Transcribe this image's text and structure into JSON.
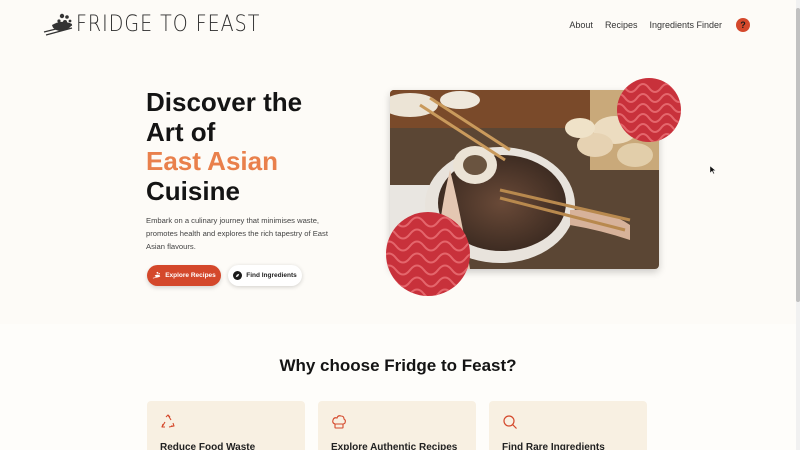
{
  "brand": {
    "name": "FRIDGE TO FEAST"
  },
  "nav": {
    "items": [
      "About",
      "Recipes",
      "Ingredients Finder"
    ],
    "help_label": "?"
  },
  "hero": {
    "title_line1": "Discover the",
    "title_line2": "Art of",
    "title_accent": "East Asian",
    "title_line4": "Cuisine",
    "description": "Embark on a culinary journey that minimises waste, promotes health and explores the rich tapestry of East Asian flavours.",
    "primary_button": "Explore Recipes",
    "secondary_button": "Find Ingredients"
  },
  "why": {
    "title": "Why choose Fridge to Feast?",
    "cards": [
      {
        "title": "Reduce Food Waste",
        "icon": "recycle-icon"
      },
      {
        "title": "Explore Authentic Recipes",
        "icon": "chef-hat-icon"
      },
      {
        "title": "Find Rare Ingredients",
        "icon": "search-icon"
      }
    ]
  },
  "colors": {
    "accent": "#d4482b",
    "accent_light": "#e9804c",
    "card_bg": "#f8f0e2",
    "page_bg": "#fdfbf7"
  }
}
